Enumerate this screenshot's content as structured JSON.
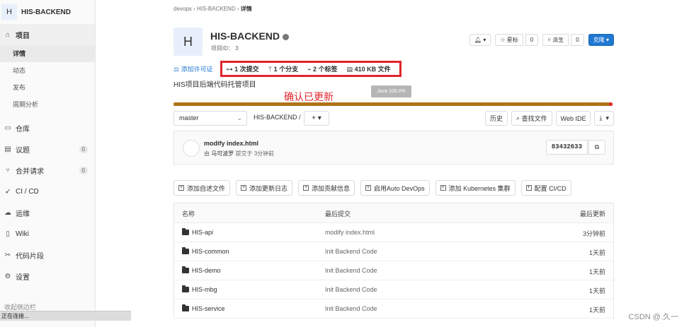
{
  "sidebar": {
    "project_initial": "H",
    "project_name": "HIS-BACKEND",
    "sections": [
      {
        "label": "项目",
        "icon": "home-icon"
      },
      {
        "label": "仓库",
        "icon": "repo-icon"
      },
      {
        "label": "议题",
        "icon": "issues-icon",
        "badge": "0"
      },
      {
        "label": "合并请求",
        "icon": "merge-icon",
        "badge": "0"
      },
      {
        "label": "CI / CD",
        "icon": "rocket-icon"
      },
      {
        "label": "运维",
        "icon": "cloud-icon"
      },
      {
        "label": "Wiki",
        "icon": "book-icon"
      },
      {
        "label": "代码片段",
        "icon": "scissors-icon"
      },
      {
        "label": "设置",
        "icon": "gear-icon"
      }
    ],
    "project_subitems": [
      "详情",
      "动态",
      "发布",
      "周期分析"
    ],
    "collapse_label": "收起侧边栏",
    "status_text": "正在连接..."
  },
  "breadcrumb": {
    "group": "devops",
    "project": "HIS-BACKEND",
    "current": "详情"
  },
  "project": {
    "initial": "H",
    "name": "HIS-BACKEND",
    "id_label": "项目ID： 3",
    "description": "HIS项目后端代码托管项目"
  },
  "actions": {
    "notify_caret": "▾",
    "star_label": "星标",
    "star_count": "0",
    "fork_label": "派生",
    "fork_count": "0",
    "clone_label": "克隆"
  },
  "stats": {
    "license_label": "添加许可证",
    "commits": "1 次提交",
    "branches": "1 个分支",
    "tags": "2 个标签",
    "files": "410 KB 文件"
  },
  "annotation": "确认已更新",
  "language": {
    "tooltip": "Java 100.0%",
    "color": "#b07219",
    "percent": 100
  },
  "repo": {
    "branch": "master",
    "path": "HIS-BACKEND",
    "history_label": "历史",
    "find_label": "查找文件",
    "webide_label": "Web IDE"
  },
  "last_commit": {
    "title": "modify index.html",
    "author_prefix": "由",
    "author": "马可波罗",
    "time": "提交于 3分钟前",
    "sha": "83432633"
  },
  "quick_actions": [
    "添加自述文件",
    "添加更新日志",
    "添加贡献信息",
    "启用Auto DevOps",
    "添加 Kubernetes 集群",
    "配置 CI/CD"
  ],
  "table": {
    "headers": [
      "名称",
      "最后提交",
      "最后更新"
    ],
    "rows": [
      {
        "name": "HIS-api",
        "commit": "modify index.html",
        "updated": "3分钟前"
      },
      {
        "name": "HIS-common",
        "commit": "Init Backend Code",
        "updated": "1天前"
      },
      {
        "name": "HIS-demo",
        "commit": "Init Backend Code",
        "updated": "1天前"
      },
      {
        "name": "HIS-mbg",
        "commit": "Init Backend Code",
        "updated": "1天前"
      },
      {
        "name": "HIS-service",
        "commit": "Init Backend Code",
        "updated": "1天前"
      }
    ]
  },
  "watermark": "CSDN @.久一",
  "colors": {
    "accent": "#1f78d1",
    "highlight": "#e0252c",
    "java": "#b07219"
  }
}
